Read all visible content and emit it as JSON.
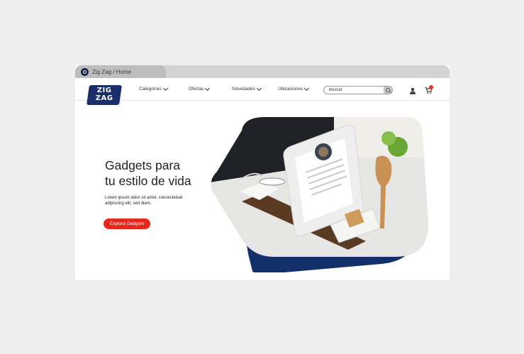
{
  "browser": {
    "tab_title": "Zig Zag / Home"
  },
  "header": {
    "logo_text": "ZIG ZAG",
    "logo_line1": "ZIG",
    "logo_line2": "ZAG",
    "nav": [
      "Categorías",
      "Ofertas",
      "Novedades",
      "Ubicaciones"
    ],
    "search_placeholder": "Buscar"
  },
  "hero": {
    "title_line1": "Gadgets para",
    "title_line2": "tu estilo de vida",
    "description": "Lorem ipsum dolor sit amet, consectetuer adipiscing elit, sed diam.",
    "cta_label": "Explora Gadgets"
  },
  "colors": {
    "brand_navy": "#1a2f6a",
    "accent_red": "#e5281b",
    "page_bg": "#eeeeee"
  },
  "icons": [
    "zigzag-favicon-icon",
    "chevron-down-icon",
    "search-icon",
    "user-icon",
    "cart-icon"
  ]
}
